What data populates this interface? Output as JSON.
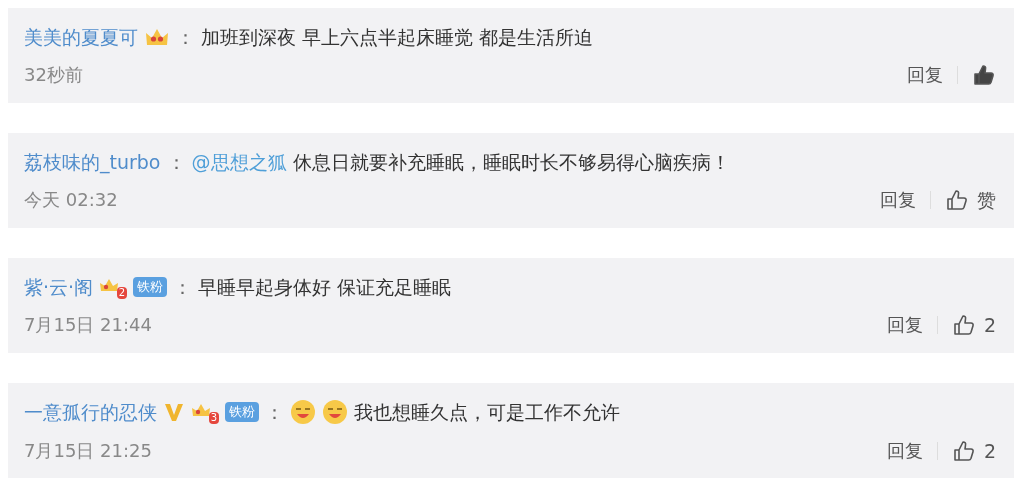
{
  "comments": [
    {
      "author": "美美的夏夏可",
      "badges": [
        {
          "kind": "crown"
        }
      ],
      "colon": "：",
      "content": [
        {
          "kind": "text",
          "text": "加班到深夜 早上六点半起床睡觉 都是生活所迫"
        }
      ],
      "time": "32秒前",
      "reply": "回复",
      "liked": true
    },
    {
      "author": "荔枝味的_turbo",
      "colon": "：",
      "content": [
        {
          "kind": "mention",
          "text": "@思想之狐"
        },
        {
          "kind": "text",
          "text": "休息日就要补充睡眠，睡眠时长不够易得心脑疾病！"
        }
      ],
      "time": "今天 02:32",
      "reply": "回复",
      "liked": false,
      "like_label": "赞"
    },
    {
      "author": "紫·云·阁",
      "badges": [
        {
          "kind": "fan",
          "text": "2"
        },
        {
          "kind": "tag",
          "text": "铁粉"
        }
      ],
      "colon": "：",
      "content": [
        {
          "kind": "text",
          "text": "早睡早起身体好 保证充足睡眠"
        }
      ],
      "time": "7月15日 21:44",
      "reply": "回复",
      "liked": false,
      "like_label": "2"
    },
    {
      "author": "一意孤行的忍侠",
      "badges": [
        {
          "kind": "verified"
        },
        {
          "kind": "fan",
          "text": "3"
        },
        {
          "kind": "tag",
          "text": "铁粉"
        }
      ],
      "colon": "：",
      "content": [
        {
          "kind": "emoji"
        },
        {
          "kind": "emoji"
        },
        {
          "kind": "plain",
          "text": "我也想睡久点，可是工作不允许"
        }
      ],
      "time": "7月15日 21:25",
      "reply": "回复",
      "liked": false,
      "like_label": "2"
    }
  ]
}
